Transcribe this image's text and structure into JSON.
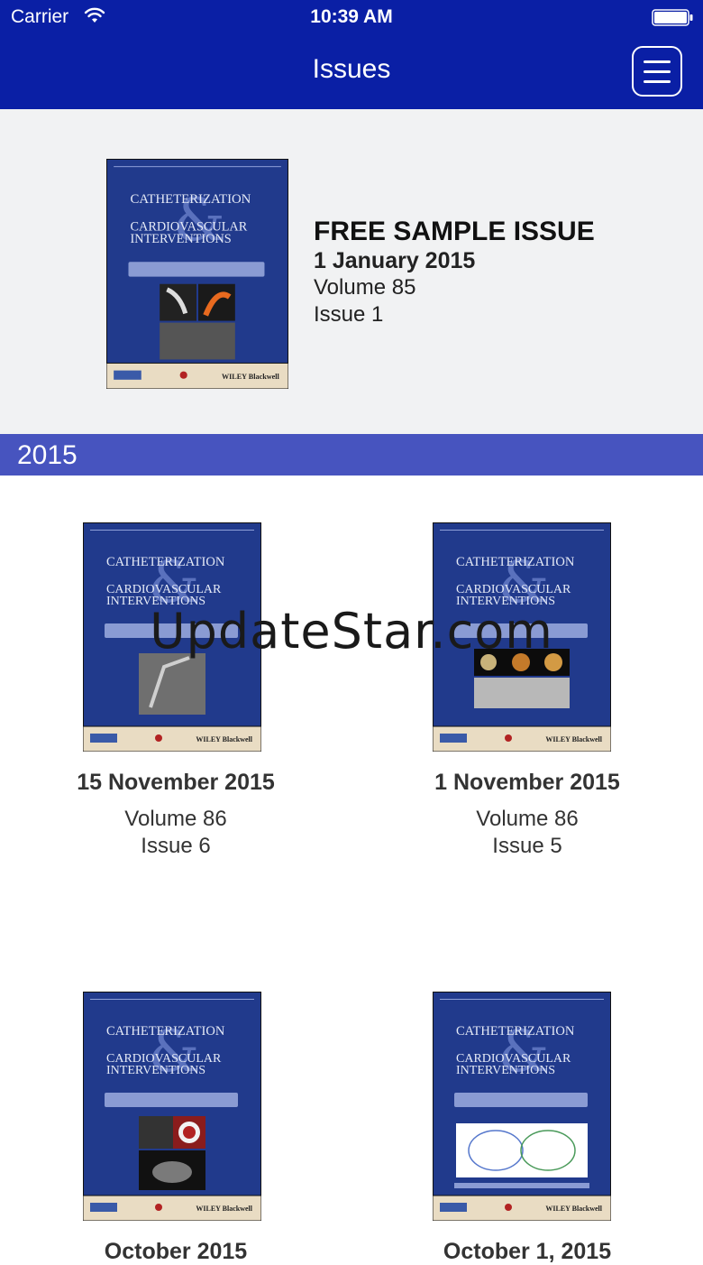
{
  "status_bar": {
    "carrier": "Carrier",
    "time": "10:39 AM"
  },
  "nav": {
    "title": "Issues",
    "menu_icon": "hamburger-menu-icon"
  },
  "featured": {
    "label": "FREE SAMPLE ISSUE",
    "date": "1 January 2015",
    "volume": "Volume 85",
    "issue": "Issue 1"
  },
  "cover": {
    "title_line1": "CATHETERIZATION",
    "title_line2": "CARDIOVASCULAR",
    "title_line3": "INTERVENTIONS",
    "ampersand": "&",
    "publisher": "WILEY Blackwell",
    "background_color": "#213a8c",
    "footer_color": "#e9dcc3"
  },
  "year_section": {
    "year": "2015",
    "color": "#4754bf"
  },
  "issues": [
    {
      "date": "15 November 2015",
      "volume": "Volume 86",
      "issue": "Issue 6"
    },
    {
      "date": "1 November 2015",
      "volume": "Volume 86",
      "issue": "Issue 5"
    },
    {
      "date": "October 2015",
      "volume": "",
      "issue": ""
    },
    {
      "date": "October 1, 2015",
      "volume": "",
      "issue": ""
    }
  ],
  "watermark": "UpdateStar.com",
  "colors": {
    "nav_bar": "#0a1fa5",
    "featured_bg": "#f1f2f3"
  }
}
